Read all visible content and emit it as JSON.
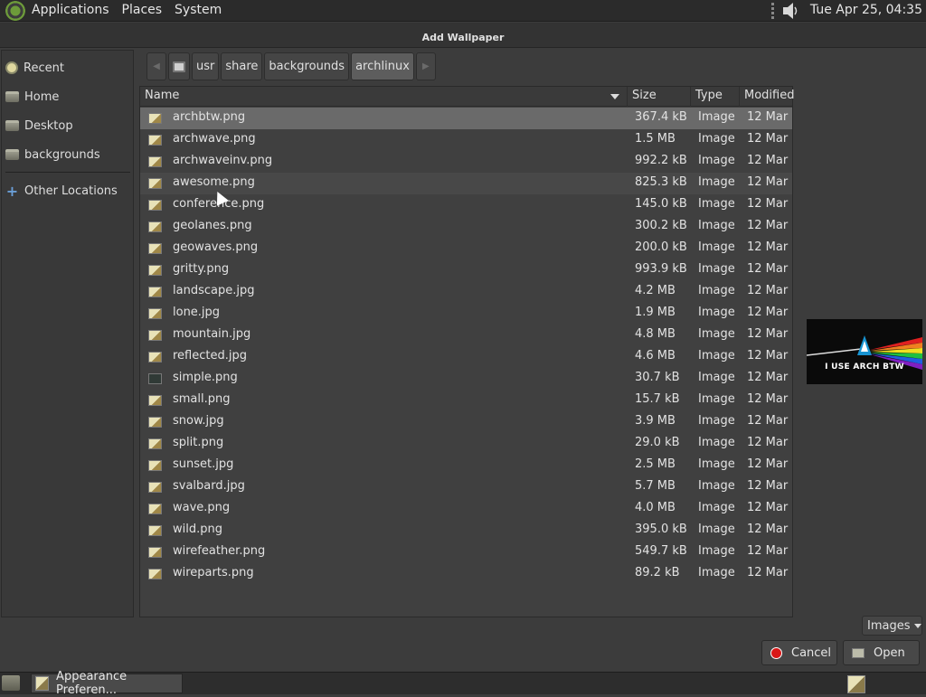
{
  "top_panel": {
    "menus": [
      "Applications",
      "Places",
      "System"
    ],
    "clock": "Tue Apr 25, 04:35"
  },
  "dialog": {
    "title": "Add Wallpaper"
  },
  "sidebar": {
    "items": [
      {
        "label": "Recent",
        "icon": "clock-icon"
      },
      {
        "label": "Home",
        "icon": "folder-icon"
      },
      {
        "label": "Desktop",
        "icon": "folder-icon"
      },
      {
        "label": "backgrounds",
        "icon": "folder-icon"
      },
      {
        "label": "Other Locations",
        "icon": "plus-icon"
      }
    ]
  },
  "pathbar": {
    "segments": [
      "usr",
      "share",
      "backgrounds",
      "archlinux"
    ],
    "active": "archlinux"
  },
  "file_list": {
    "columns": [
      "Name",
      "Size",
      "Type",
      "Modified"
    ],
    "sort_column": "Name",
    "rows": [
      {
        "name": "archbtw.png",
        "size": "367.4 kB",
        "type": "Image",
        "modified": "12 Mar"
      },
      {
        "name": "archwave.png",
        "size": "1.5 MB",
        "type": "Image",
        "modified": "12 Mar"
      },
      {
        "name": "archwaveinv.png",
        "size": "992.2 kB",
        "type": "Image",
        "modified": "12 Mar"
      },
      {
        "name": "awesome.png",
        "size": "825.3 kB",
        "type": "Image",
        "modified": "12 Mar"
      },
      {
        "name": "conference.png",
        "size": "145.0 kB",
        "type": "Image",
        "modified": "12 Mar"
      },
      {
        "name": "geolanes.png",
        "size": "300.2 kB",
        "type": "Image",
        "modified": "12 Mar"
      },
      {
        "name": "geowaves.png",
        "size": "200.0 kB",
        "type": "Image",
        "modified": "12 Mar"
      },
      {
        "name": "gritty.png",
        "size": "993.9 kB",
        "type": "Image",
        "modified": "12 Mar"
      },
      {
        "name": "landscape.jpg",
        "size": "4.2 MB",
        "type": "Image",
        "modified": "12 Mar"
      },
      {
        "name": "lone.jpg",
        "size": "1.9 MB",
        "type": "Image",
        "modified": "12 Mar"
      },
      {
        "name": "mountain.jpg",
        "size": "4.8 MB",
        "type": "Image",
        "modified": "12 Mar"
      },
      {
        "name": "reflected.jpg",
        "size": "4.6 MB",
        "type": "Image",
        "modified": "12 Mar"
      },
      {
        "name": "simple.png",
        "size": "30.7 kB",
        "type": "Image",
        "modified": "12 Mar"
      },
      {
        "name": "small.png",
        "size": "15.7 kB",
        "type": "Image",
        "modified": "12 Mar"
      },
      {
        "name": "snow.jpg",
        "size": "3.9 MB",
        "type": "Image",
        "modified": "12 Mar"
      },
      {
        "name": "split.png",
        "size": "29.0 kB",
        "type": "Image",
        "modified": "12 Mar"
      },
      {
        "name": "sunset.jpg",
        "size": "2.5 MB",
        "type": "Image",
        "modified": "12 Mar"
      },
      {
        "name": "svalbard.jpg",
        "size": "5.7 MB",
        "type": "Image",
        "modified": "12 Mar"
      },
      {
        "name": "wave.png",
        "size": "4.0 MB",
        "type": "Image",
        "modified": "12 Mar"
      },
      {
        "name": "wild.png",
        "size": "395.0 kB",
        "type": "Image",
        "modified": "12 Mar"
      },
      {
        "name": "wirefeather.png",
        "size": "549.7 kB",
        "type": "Image",
        "modified": "12 Mar"
      },
      {
        "name": "wireparts.png",
        "size": "89.2 kB",
        "type": "Image",
        "modified": "12 Mar"
      }
    ],
    "selected_index": 0,
    "hover_index": 3
  },
  "preview": {
    "caption": "I USE ARCH BTW"
  },
  "filter": {
    "selected": "Images"
  },
  "buttons": {
    "cancel": "Cancel",
    "open": "Open"
  },
  "taskbar": {
    "task_label": "Appearance Preferen..."
  },
  "colors": {
    "background": "#3c3c3c",
    "panel": "#2b2b2b",
    "selection": "#6a6a6a",
    "cancel_red": "#d81818"
  }
}
